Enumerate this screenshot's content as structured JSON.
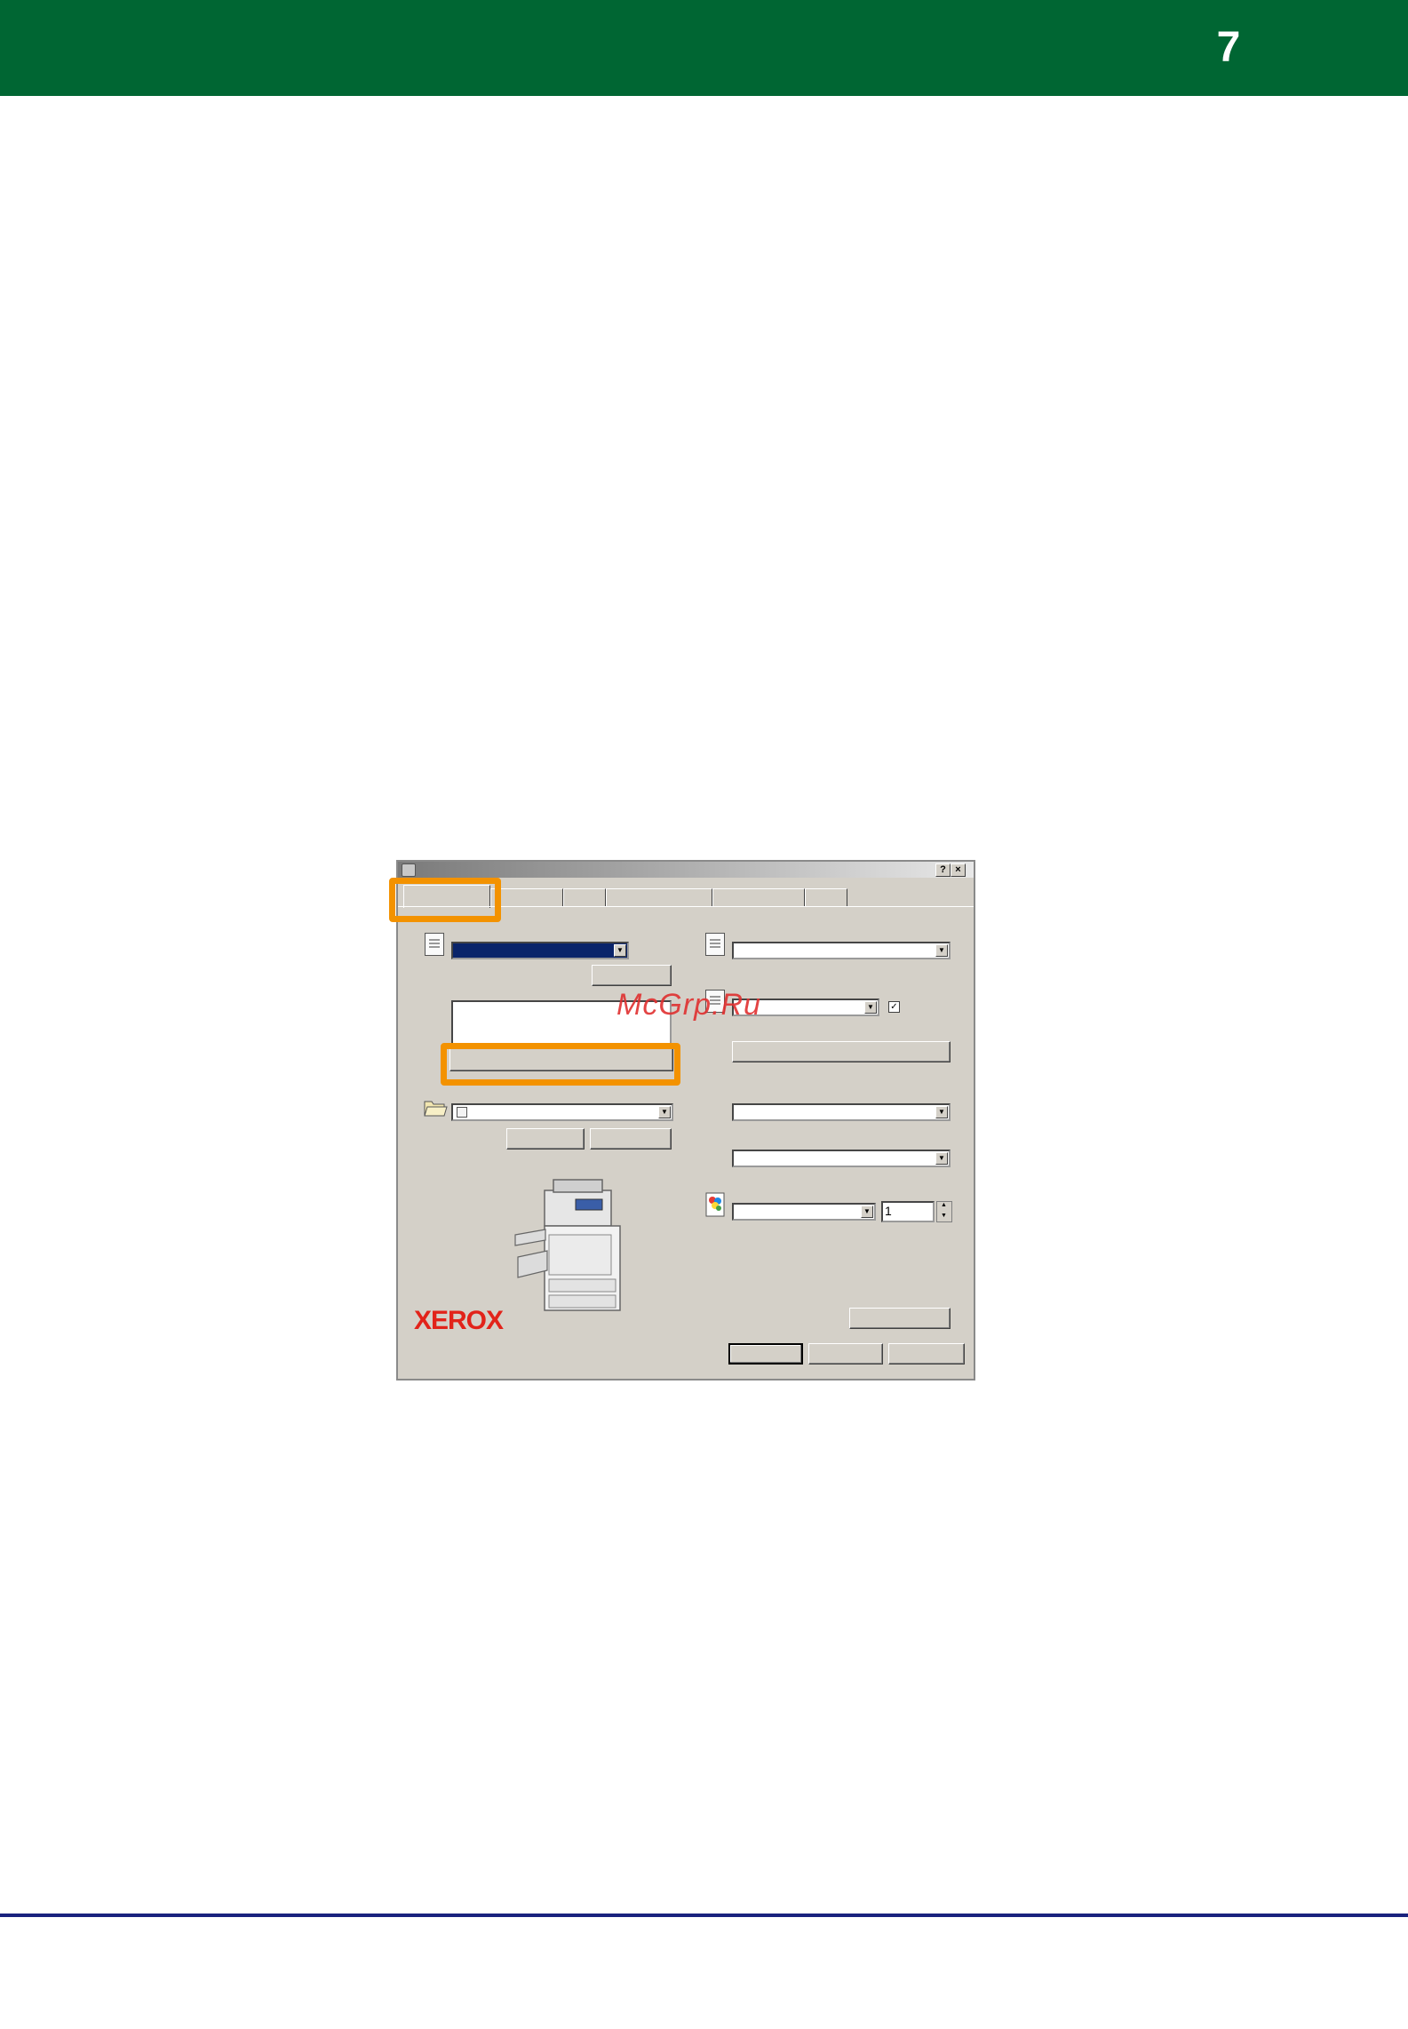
{
  "header": {
    "page_number": "7",
    "bar_color": "#006633"
  },
  "footer": {
    "rule_color": "#1a237e"
  },
  "dialog": {
    "title_buttons": {
      "help": "?",
      "close": "×"
    },
    "checkbox_checked": "✓",
    "copies_value": "1",
    "highlight_color": "#f39200"
  },
  "brand": {
    "logo_text": "XEROX",
    "logo_color": "#e2231a"
  },
  "watermark": {
    "text": "McGrp.Ru"
  }
}
